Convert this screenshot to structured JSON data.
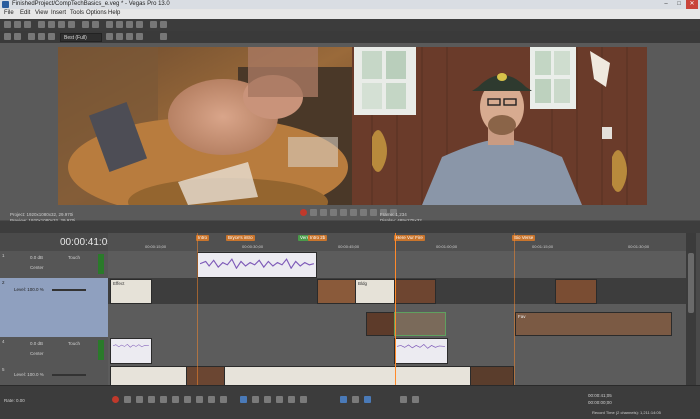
{
  "window": {
    "title": "FinishedProject/CompTechBasics_e.veg * - Vegas Pro 13.0",
    "min": "–",
    "max": "□",
    "close": "✕"
  },
  "menu": [
    "File",
    "Edit",
    "View",
    "Insert",
    "Tools",
    "Options",
    "Help"
  ],
  "toolbar": {
    "preview_mode": "Best (Full)"
  },
  "preview": {
    "info_left": [
      "Project:   1920x1080x32, 29.970i",
      "Preview:   1920x1080x32, 29.970i"
    ],
    "info_right": [
      "Frame:    1,234",
      "Display:  489x275x32"
    ]
  },
  "timeline": {
    "timecode": "00:00:41:05",
    "markers": [
      "Intro",
      "Bryce's intro",
      "Verse 1",
      "Intro 2b",
      "Here Vur Fire",
      "Bio Verse"
    ],
    "ruler_times": [
      "00:00:15;00",
      "00:00:30;00",
      "00:00:45;00",
      "00:01:00;00",
      "00:01:15;00",
      "00:01:30;00"
    ],
    "tracks": [
      {
        "type": "audio",
        "vol": "0.0 dB",
        "pan": "Center",
        "touch": "Touch"
      },
      {
        "type": "video",
        "level": "Level: 100.0 %",
        "selected": true
      },
      {
        "type": "video",
        "level": "Level: 100.0 %"
      },
      {
        "type": "audio",
        "vol": "0.0 dB",
        "pan": "Center",
        "touch": "Touch"
      },
      {
        "type": "video",
        "level": "Level: 100.0 %"
      }
    ],
    "clip_labels": [
      "Effect",
      "Bldg",
      "Fav"
    ]
  },
  "status": {
    "rate": "Rate: 0.00",
    "record_time": "Record Time (2 channels): 1,211:14:05",
    "position": "00:00:41;05",
    "duration": "00:00:00;00"
  },
  "colors": {
    "accent": "#ff8a2a",
    "selected_track": "#8fa0bf",
    "audio_wave": "#7e5ab8"
  }
}
